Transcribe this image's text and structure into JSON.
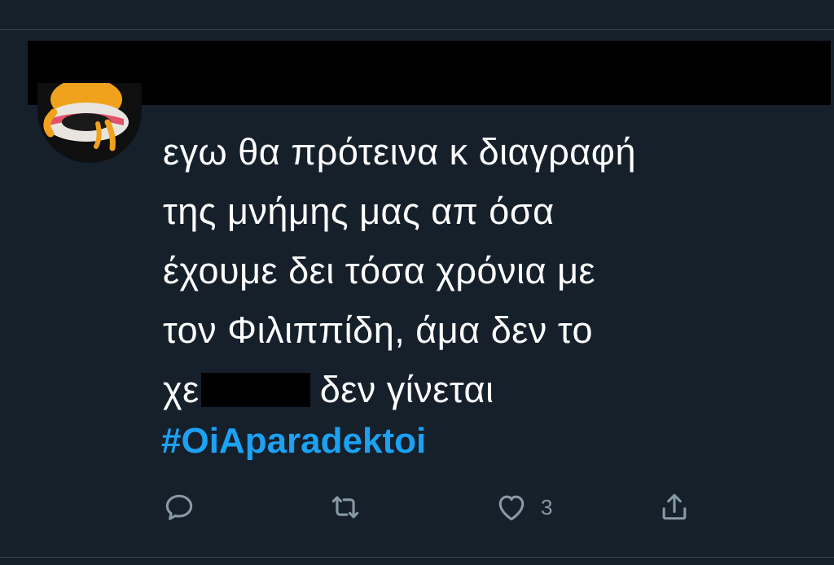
{
  "tweet": {
    "lines": [
      "εγω θα πρότεινα κ διαγραφή",
      "της μνήμης μας απ όσα",
      "έχουμε δει τόσα χρόνια με",
      "τον Φιλιππίδη, άμα δεν το"
    ],
    "line5_start": "χε",
    "line5_end": "δεν γίνεται",
    "hashtag": "#OiAparadektoi"
  },
  "actions": {
    "reply_icon": "reply-icon",
    "retweet_icon": "retweet-icon",
    "like_icon": "heart-icon",
    "like_count": "3",
    "share_icon": "share-icon"
  },
  "colors": {
    "background": "#15202b",
    "text": "#ffffff",
    "hashtag": "#1da1f2",
    "icon": "#8899a6"
  }
}
